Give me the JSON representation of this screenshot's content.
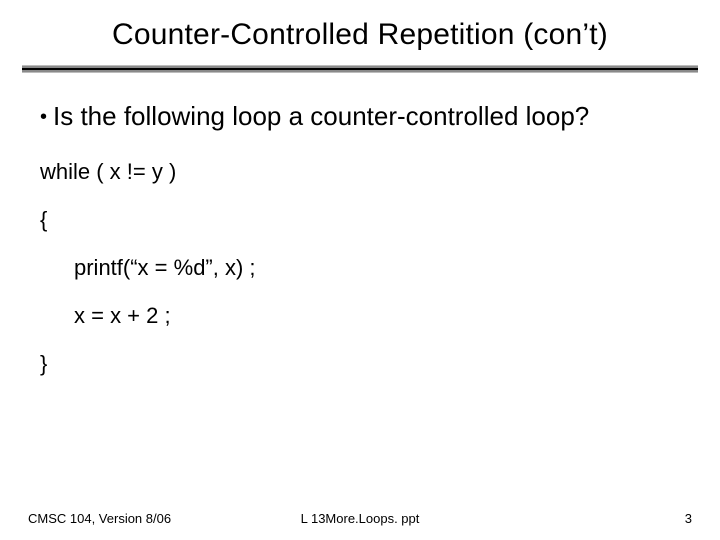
{
  "title": "Counter-Controlled Repetition (con’t)",
  "bullet": {
    "marker": "•",
    "text": "Is the following loop a counter-controlled loop?"
  },
  "code": {
    "l1": "while ( x != y )",
    "l2": "{",
    "l3": "printf(“x = %d”, x) ;",
    "l4": "x = x + 2 ;",
    "l5": "}"
  },
  "footer": {
    "left": "CMSC 104, Version 8/06",
    "center": "L 13More.Loops. ppt",
    "right": "3"
  }
}
